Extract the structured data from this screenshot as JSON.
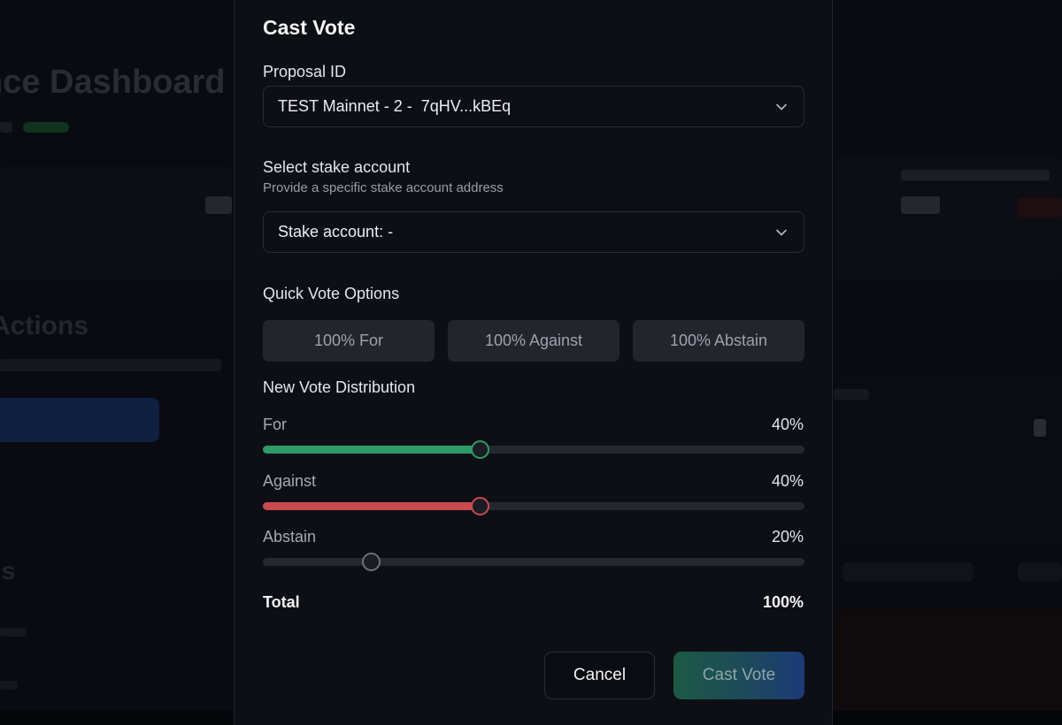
{
  "background": {
    "title": "nce Dashboard",
    "section_title": "Actions",
    "bottom_title": "ls"
  },
  "modal": {
    "title": "Cast Vote",
    "proposal": {
      "label": "Proposal ID",
      "selected": "TEST Mainnet - 2 -  7qHV...kBEq"
    },
    "stake": {
      "label": "Select stake account",
      "hint": "Provide a specific stake account address",
      "selected": "Stake account: -"
    },
    "quick": {
      "label": "Quick Vote Options",
      "options": [
        "100% For",
        "100% Against",
        "100% Abstain"
      ]
    },
    "distribution": {
      "label": "New Vote Distribution",
      "sliders": [
        {
          "label": "For",
          "value_text": "40%",
          "value": 0.4,
          "color": "#2e9a68"
        },
        {
          "label": "Against",
          "value_text": "40%",
          "value": 0.4,
          "color": "#c94a52"
        },
        {
          "label": "Abstain",
          "value_text": "20%",
          "value": 0.2,
          "color": "#6c6f7a"
        }
      ]
    },
    "total": {
      "label": "Total",
      "value": "100%"
    },
    "buttons": {
      "cancel": "Cancel",
      "cast": "Cast Vote"
    }
  }
}
